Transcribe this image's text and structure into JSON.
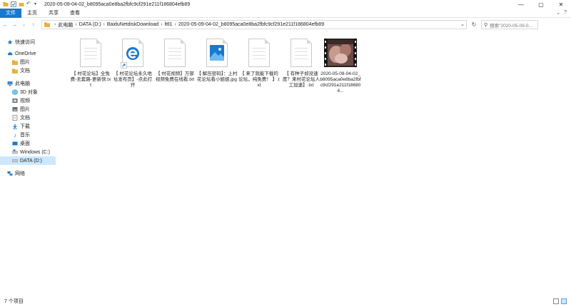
{
  "window": {
    "title": "2020-05-09-04-02_b8095aca0e8ba2fbfc9cf291e211f186804efb89",
    "controls": [
      "—",
      "▢",
      "✕"
    ]
  },
  "ribbon": {
    "tabs": [
      {
        "label": "文件",
        "active": true
      },
      {
        "label": "主页",
        "active": false
      },
      {
        "label": "共享",
        "active": false
      },
      {
        "label": "查看",
        "active": false
      }
    ],
    "right_glyphs": [
      "⌄",
      "?"
    ]
  },
  "address": {
    "crumbs": [
      "此电脑",
      "DATA (D:)",
      "BaiduNetdiskDownload",
      "lttl1",
      "2020-05-09-04-02_b8095aca0e8ba2fbfc9cf291e211f186804efb89"
    ],
    "search_placeholder": "搜索\"2020-05-09-0..."
  },
  "sidebar": {
    "items": [
      {
        "label": "快速访问",
        "icon": "star-icon",
        "color": "#1979ca",
        "indent": 0
      },
      {
        "label": "OneDrive",
        "icon": "cloud-icon",
        "color": "#1979ca",
        "indent": 0
      },
      {
        "label": "图片",
        "icon": "folder-icon",
        "color": "#e8b33b",
        "indent": 1
      },
      {
        "label": "文档",
        "icon": "folder-icon",
        "color": "#e8b33b",
        "indent": 1
      },
      {
        "label": "此电脑",
        "icon": "computer-icon",
        "color": "#3a8ad6",
        "indent": 0
      },
      {
        "label": "3D 对象",
        "icon": "cube-icon",
        "color": "#3aa0e0",
        "indent": 1
      },
      {
        "label": "视频",
        "icon": "video-icon",
        "color": "#555",
        "indent": 1
      },
      {
        "label": "图片",
        "icon": "pictures-icon",
        "color": "#555",
        "indent": 1
      },
      {
        "label": "文档",
        "icon": "documents-icon",
        "color": "#555",
        "indent": 1
      },
      {
        "label": "下载",
        "icon": "download-icon",
        "color": "#1979ca",
        "indent": 1
      },
      {
        "label": "音乐",
        "icon": "music-icon",
        "color": "#1979ca",
        "indent": 1
      },
      {
        "label": "桌面",
        "icon": "desktop-icon",
        "color": "#1979ca",
        "indent": 1
      },
      {
        "label": "Windows (C:)",
        "icon": "drive-icon",
        "color": "#1979ca",
        "indent": 1
      },
      {
        "label": "DATA (D:)",
        "icon": "drive-icon",
        "color": "#555",
        "indent": 1,
        "selected": true
      },
      {
        "label": "网络",
        "icon": "network-icon",
        "color": "#1979ca",
        "indent": 0
      }
    ]
  },
  "files": [
    {
      "name": "【 村花论坛】全免费-无套路-更新快.txt",
      "type": "txt"
    },
    {
      "name": "【 村花论坛永久地址发布页】-点此打开",
      "type": "shortcut"
    },
    {
      "name": "【 村花视频】万部视频免费在线看.txt",
      "type": "txt"
    },
    {
      "name": "【 解压密码】：上村花论坛看小姐姐.jpg",
      "type": "jpg"
    },
    {
      "name": "【 来了就能下载的论坛，纯免费！ 】.txt",
      "type": "txt"
    },
    {
      "name": "【 有种子却没速度？来村花论坛人工加速】.txt",
      "type": "txt"
    },
    {
      "name": "2020-05-09-04-02_b8095aca0e8ba2fbfc9cf291e211f186804...",
      "type": "video"
    }
  ],
  "status": {
    "count": "7 个项目"
  }
}
